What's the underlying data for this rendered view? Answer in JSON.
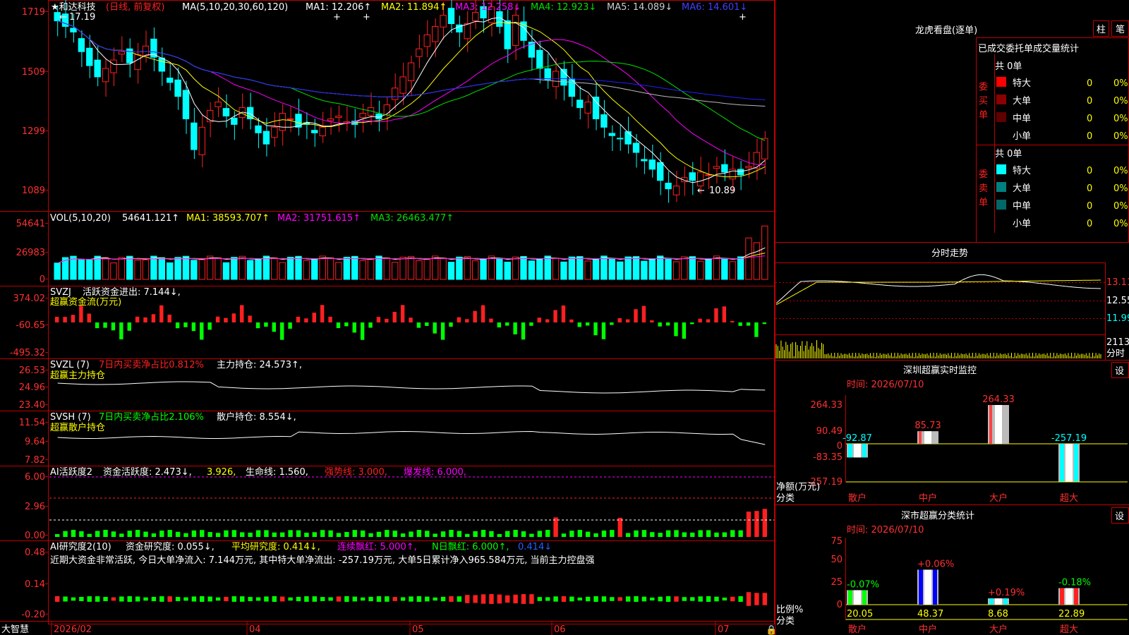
{
  "colors": {
    "up": "#ff2020",
    "down": "#00ffff",
    "frame": "#c00000",
    "ma1": "#ffffff",
    "ma2": "#ffff00",
    "ma3": "#ff00ff",
    "ma4": "#00e000",
    "ma5": "#bbbbbb",
    "ma6": "#2020ff",
    "green": "#00ff00",
    "yellow": "#ffff00"
  },
  "yaxis": {
    "price": [
      "1719",
      "1509",
      "1299",
      "1089"
    ],
    "vol": [
      "54641",
      "26983",
      "0"
    ],
    "svzj": [
      "374.02",
      "-60.65",
      "-495.32"
    ],
    "svzl": [
      "26.53",
      "24.96",
      "23.40"
    ],
    "svsh": [
      "11.54",
      "9.64",
      "7.82"
    ],
    "ai1": [
      "6.00",
      "2.96",
      "0.00"
    ],
    "ai2": [
      "0.48",
      "0.14",
      "-0.20"
    ]
  },
  "main": {
    "title": "★和达科技",
    "period": "(日线, 前复权)",
    "ma_label": "MA(5,10,20,30,60,120)",
    "ma": [
      {
        "t": "MA1: 12.206↑",
        "c": "#ffffff"
      },
      {
        "t": "MA2: 11.894↑",
        "c": "#ffff00"
      },
      {
        "t": "MA3: 12.258↓",
        "c": "#ff00ff"
      },
      {
        "t": "MA4: 12.923↓",
        "c": "#00e000"
      },
      {
        "t": "MA5: 14.089↓",
        "c": "#cccccc"
      },
      {
        "t": "MA6: 14.601↓",
        "c": "#4040ff"
      }
    ],
    "high_mark": "17.19",
    "low_mark": "10.89"
  },
  "vol": {
    "label": "VOL(5,10,20)",
    "val": "54641.121↑",
    "ma1": "MA1: 38593.707↑",
    "ma2": "MA2: 31751.615↑",
    "ma3": "MA3: 26463.477↑"
  },
  "svzj": {
    "name": "SVZJ",
    "label": "活跃资金进出: 7.144↓,",
    "sub": "超赢资金流(万元)"
  },
  "svzl": {
    "name": "SVZL (7)",
    "pct": "7日内买卖净占比0.812%",
    "hold": "主力持仓: 24.573↑,",
    "sub": "超赢主力持仓"
  },
  "svsh": {
    "name": "SVSH (7)",
    "pct": "7日内买卖净占比2.106%",
    "hold": "散户持仓: 8.554↓,",
    "sub": "超赢散户持仓"
  },
  "ai1": {
    "name": "AI活跃度2",
    "a": "资金活跃度: 2.473↓,",
    "b": "3.926,",
    "c": "生命线: 1.560,",
    "d": "强势线: 3.000,",
    "e": "爆发线: 6.000,"
  },
  "ai2": {
    "name": "AI研究度2(10)",
    "a": "资金研究度: 0.055↓,",
    "b": "平均研究度: 0.414↓,",
    "c": "连续飘红: 5.000↑,",
    "d": "N日飘红: 6.000↑,",
    "e": "0.414↓",
    "note": "近期大资金非常活跃, 今日大单净流入: 7.144万元, 其中特大单净流出: -257.19万元, 大单5日累计净入965.584万元, 当前主力控盘强"
  },
  "dates": [
    "2026/02",
    "04",
    "05",
    "06",
    "07"
  ],
  "brand": "大智慧",
  "lhb": {
    "title": "龙虎看盘(逐单)",
    "tab1": "柱",
    "tab2": "笔",
    "header": "已成交委托单成交量统计"
  },
  "orders": {
    "buy_label": "委买单",
    "sell_label": "委卖单",
    "buy_total": "共 0单",
    "sell_total": "共 0单",
    "buy": [
      {
        "l": "特大",
        "v": "0",
        "p": "0%",
        "c": "#ff0000"
      },
      {
        "l": "大单",
        "v": "0",
        "p": "0%",
        "c": "#8b0000"
      },
      {
        "l": "中单",
        "v": "0",
        "p": "0%",
        "c": "#600000"
      },
      {
        "l": "小单",
        "v": "0",
        "p": "0%",
        "c": ""
      }
    ],
    "sell": [
      {
        "l": "特大",
        "v": "0",
        "p": "0%",
        "c": "#00ffff"
      },
      {
        "l": "大单",
        "v": "0",
        "p": "0%",
        "c": "#008080"
      },
      {
        "l": "中单",
        "v": "0",
        "p": "0%",
        "c": "#006868"
      },
      {
        "l": "小单",
        "v": "0",
        "p": "0%",
        "c": ""
      }
    ]
  },
  "intraday": {
    "title": "分时走势",
    "y": [
      "13.11",
      "12.55",
      "11.99"
    ],
    "vol": "2113",
    "vol_unit": "分时"
  },
  "monitor": {
    "title": "深圳超赢实时监控",
    "set": "设",
    "date": "时间: 2026/07/10",
    "y": [
      "264.33",
      "90.49",
      "0",
      "-83.35",
      "-257.19"
    ],
    "unit1": "净额(万元)",
    "unit2": "分类",
    "bars": [
      {
        "cat": "散户",
        "v": -92.87,
        "label": "-92.87"
      },
      {
        "cat": "中户",
        "v": 85.73,
        "label": "85.73"
      },
      {
        "cat": "大户",
        "v": 264.33,
        "label": "264.33"
      },
      {
        "cat": "超大",
        "v": -257.19,
        "label": "-257.19"
      }
    ]
  },
  "classify": {
    "title": "深市超赢分类统计",
    "set": "设",
    "date": "时间: 2026/07/10",
    "y": [
      "75",
      "50",
      "25",
      "0"
    ],
    "unit1": "比例%",
    "unit2": "分类",
    "bars": [
      {
        "cat": "散户",
        "v": 20.05,
        "delta": "-0.07%",
        "c": "#00ff00"
      },
      {
        "cat": "中户",
        "v": 48.37,
        "delta": "+0.06%",
        "c": "#0000ff"
      },
      {
        "cat": "大户",
        "v": 8.68,
        "delta": "+0.19%",
        "c": "#00ffff"
      },
      {
        "cat": "超大",
        "v": 22.89,
        "delta": "-0.18%",
        "c": "#ff2020"
      }
    ]
  }
}
